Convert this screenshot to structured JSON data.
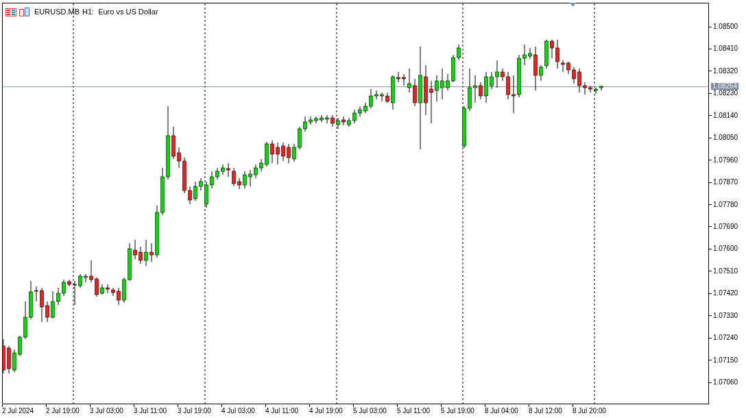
{
  "chart": {
    "symbol": "EURUSD.MB",
    "timeframe": "H1:",
    "description": "Euro vs US Dollar",
    "current_price": "1.08254",
    "price_labels": [
      "1.08500",
      "1.08410",
      "1.08320",
      "1.08230",
      "1.08140",
      "1.08050",
      "1.07960",
      "1.07870",
      "1.07780",
      "1.07690",
      "1.07600",
      "1.07510",
      "1.07420",
      "1.07330",
      "1.07240",
      "1.07150",
      "1.07060"
    ],
    "time_labels": [
      "2 Jul 2024",
      "2 Jul 19:00",
      "3 Jul 03:00",
      "3 Jul 11:00",
      "3 Jul 19:00",
      "4 Jul 03:00",
      "4 Jul 11:00",
      "4 Jul 19:00",
      "5 Jul 03:00",
      "5 Jul 11:00",
      "5 Jul 19:00",
      "8 Jul 04:00",
      "8 Jul 12:00",
      "8 Jul 20:00"
    ]
  }
}
